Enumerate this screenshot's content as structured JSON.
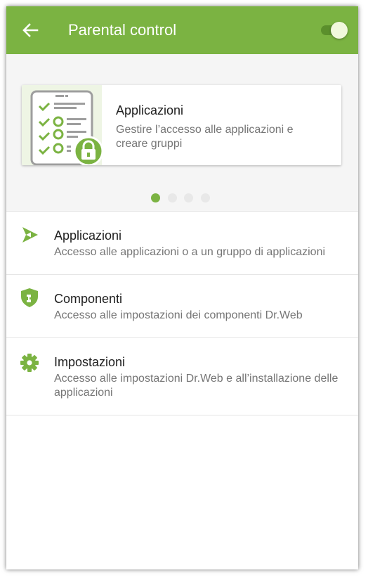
{
  "app_bar": {
    "title": "Parental control",
    "back_icon": "arrow-left-icon",
    "toggle_on": true,
    "color": "#7bb342"
  },
  "banner": {
    "title": "Applicazioni",
    "description": "Gestire l’accesso alle applicazioni e creare gruppi",
    "illustration_icon": "checklist-lock-icon",
    "pages": 4,
    "active_page": 1
  },
  "list": [
    {
      "icon": "play-arrow-icon",
      "title": "Applicazioni",
      "description": "Accesso alle applicazioni o a un gruppo di applicazioni"
    },
    {
      "icon": "shield-icon",
      "title": "Componenti",
      "description": "Accesso alle impostazioni dei componenti Dr.Web"
    },
    {
      "icon": "gear-icon",
      "title": "Impostazioni",
      "description": "Accesso alle impostazioni Dr.Web e all’installazione delle applicazioni"
    }
  ]
}
